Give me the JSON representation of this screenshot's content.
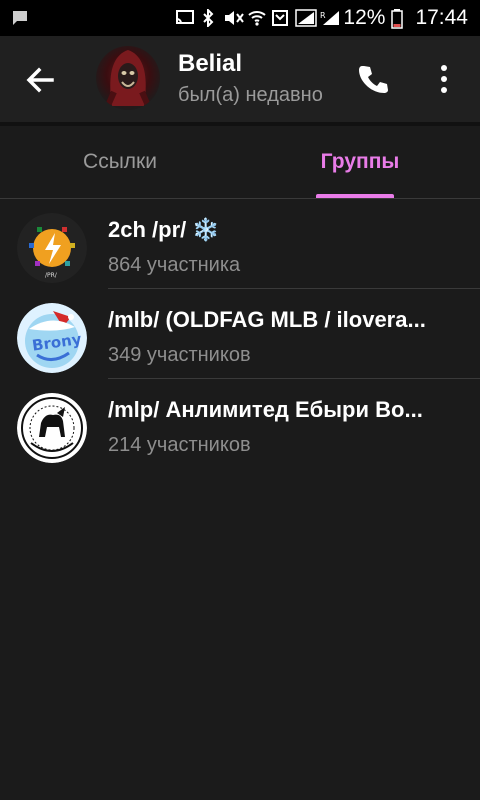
{
  "status_bar": {
    "battery_percent": "12%",
    "time": "17:44",
    "icons": [
      "message-icon",
      "cast-icon",
      "bluetooth-icon",
      "mute-icon",
      "wifi-icon",
      "sim-icon",
      "signal-icon",
      "signal-roaming-icon",
      "battery-icon"
    ]
  },
  "header": {
    "name": "Belial",
    "status": "был(а) недавно"
  },
  "tabs": [
    {
      "label": "Ссылки",
      "active": false
    },
    {
      "label": "Группы",
      "active": true
    }
  ],
  "colors": {
    "accent": "#e97ce8",
    "background": "#1b1b1b",
    "toolbar": "#202020",
    "secondary_text": "#8e8e8e"
  },
  "groups": [
    {
      "title": "2ch /pr/ ❄️",
      "members": "864 участника"
    },
    {
      "title": "/mlb/ (OLDFAG MLB / ilovera...",
      "members": "349 участников"
    },
    {
      "title": "/mlp/ Анлимитед Ебыри Во...",
      "members": "214 участников"
    }
  ]
}
